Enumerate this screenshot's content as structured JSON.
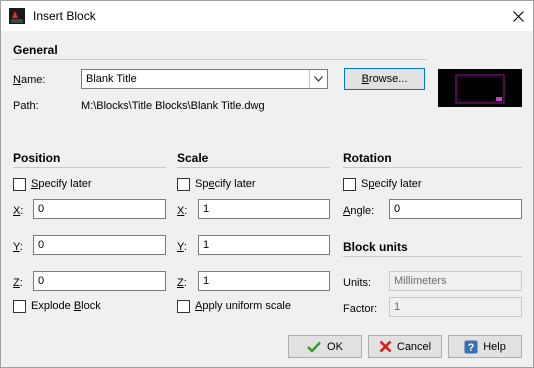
{
  "window": {
    "title": "Insert Block",
    "close_symbol": "✕"
  },
  "general": {
    "heading": "General",
    "name_label": "Name:",
    "name_value": "Blank Title",
    "browse_label": "Browse...",
    "path_label": "Path:",
    "path_value": "M:\\Blocks\\Title Blocks\\Blank Title.dwg"
  },
  "position": {
    "heading": "Position",
    "specify_later": "Specify later",
    "x_label": "X:",
    "x_value": "0",
    "y_label": "Y:",
    "y_value": "0",
    "z_label": "Z:",
    "z_value": "0",
    "explode_label": "Explode Block"
  },
  "scale": {
    "heading": "Scale",
    "specify_later": "Specify later",
    "x_label": "X:",
    "x_value": "1",
    "y_label": "Y:",
    "y_value": "1",
    "z_label": "Z:",
    "z_value": "1",
    "uniform_label": "Apply uniform scale"
  },
  "rotation": {
    "heading": "Rotation",
    "specify_later": "Specify later",
    "angle_label": "Angle:",
    "angle_value": "0"
  },
  "block_units": {
    "heading": "Block units",
    "units_label": "Units:",
    "units_value": "Millimeters",
    "factor_label": "Factor:",
    "factor_value": "1"
  },
  "buttons": {
    "ok": "OK",
    "cancel": "Cancel",
    "help": "Help"
  },
  "colors": {
    "ok_check": "#2e9e2e",
    "cancel_x": "#d42020",
    "help_icon": "#3a6fb0",
    "focus": "#0078d7"
  }
}
